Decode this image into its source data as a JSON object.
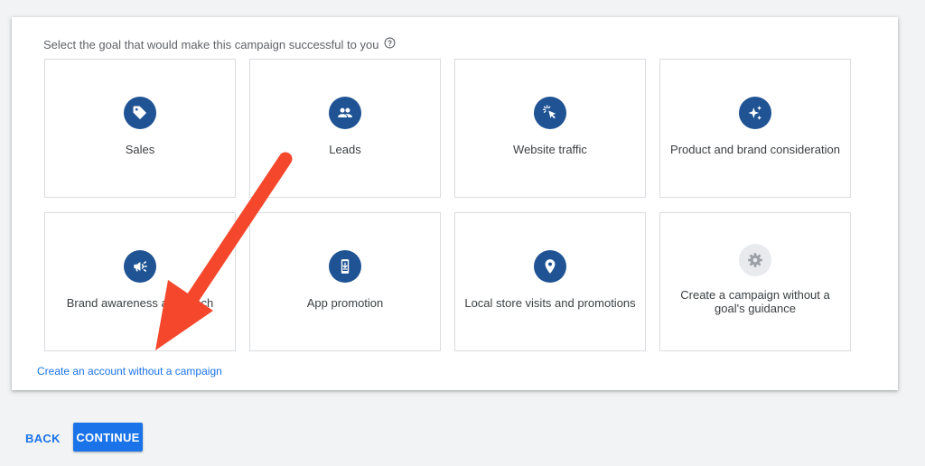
{
  "prompt": {
    "text": "Select the goal that would make this campaign successful to you",
    "help_icon": "help-circle-icon"
  },
  "goals": [
    {
      "label": "Sales",
      "icon": "tag-icon"
    },
    {
      "label": "Leads",
      "icon": "people-icon"
    },
    {
      "label": "Website traffic",
      "icon": "cursor-click-icon"
    },
    {
      "label": "Product and brand consideration",
      "icon": "sparkle-icon"
    },
    {
      "label": "Brand awareness and reach",
      "icon": "megaphone-icon"
    },
    {
      "label": "App promotion",
      "icon": "phone-download-icon"
    },
    {
      "label": "Local store visits and promotions",
      "icon": "location-pin-icon"
    },
    {
      "label": "Create a campaign without a goal's guidance",
      "icon": "gear-icon"
    }
  ],
  "link": {
    "text": "Create an account without a campaign"
  },
  "footer": {
    "back_label": "BACK",
    "continue_label": "CONTINUE"
  },
  "colors": {
    "icon_circle": "#1f5393",
    "icon_circle_neutral": "#e8eaed",
    "primary": "#1a73e8",
    "annotation_arrow": "#f4472b"
  }
}
